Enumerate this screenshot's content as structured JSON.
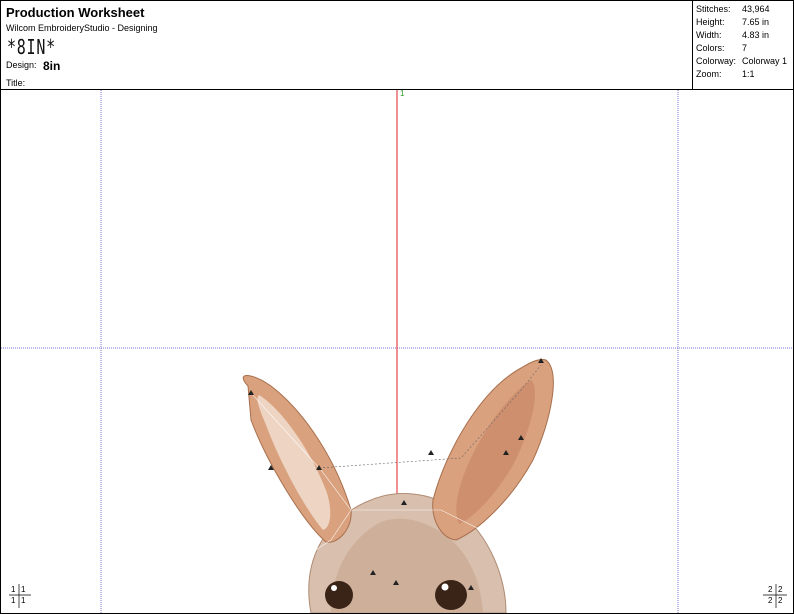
{
  "header": {
    "title": "Production Worksheet",
    "app": "Wilcom EmbroideryStudio - Designing",
    "monogram": "*8IN*",
    "design_label": "Design:",
    "design_value": "8in",
    "title_label": "Title:"
  },
  "stats": [
    {
      "label": "Stitches:",
      "value": "43,964"
    },
    {
      "label": "Height:",
      "value": "7.65 in"
    },
    {
      "label": "Width:",
      "value": "4.83 in"
    },
    {
      "label": "Colors:",
      "value": "7"
    },
    {
      "label": "Colorway:",
      "value": "Colorway 1"
    },
    {
      "label": "Zoom:",
      "value": "1:1"
    }
  ],
  "canvas": {
    "top_marker": "1",
    "corner_left": [
      "1",
      "1",
      "1",
      "1"
    ],
    "corner_right": [
      "2",
      "2",
      "2",
      "2"
    ],
    "colors": {
      "guide_line": "#7777cc",
      "center_line": "#e02020",
      "ear_outer": "#d9a17d",
      "ear_inner": "#c98a6a",
      "fur": "#c9a892",
      "eye": "#3a2418"
    }
  }
}
